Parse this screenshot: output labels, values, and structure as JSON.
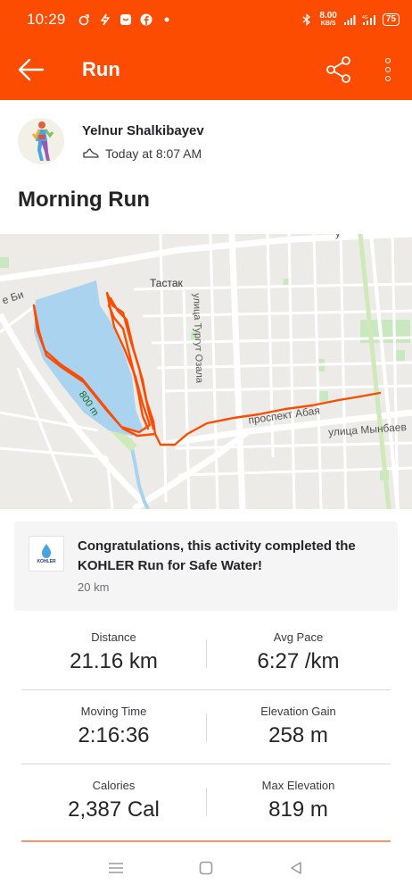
{
  "status_bar": {
    "time": "10:29",
    "net_speed_value": "8.00",
    "net_speed_unit": "KB/S",
    "battery": "75",
    "icons": [
      "strava-notification-icon",
      "lightning-icon",
      "chat-icon",
      "facebook-icon",
      "dot-icon",
      "bluetooth-icon",
      "signal-icon",
      "4g-signal-icon",
      "battery-icon"
    ]
  },
  "app_bar": {
    "title": "Run",
    "back_icon": "arrow-left-icon",
    "share_icon": "share-icon",
    "more_icon": "more-vertical-icon"
  },
  "athlete": {
    "name": "Yelnur Shalkibayev",
    "timestamp": "Today at 8:07 AM",
    "activity_icon": "shoe-icon"
  },
  "activity": {
    "title": "Morning Run"
  },
  "map": {
    "labels": {
      "district": "Тастак",
      "street_1": "улица Тургут Озала",
      "street_2": "проспект Абая",
      "street_3": "улица Мынбаев",
      "street_4": "е Би",
      "route_marker": "800 m",
      "top_fragment": "у"
    },
    "route_color": "#fc4c02",
    "water_color": "#aad3f0"
  },
  "challenge": {
    "title": "Congratulations, this activity completed the KOHLER Run for Safe Water!",
    "subtitle": "20 km",
    "badge_text": "KOHLER"
  },
  "stats": [
    {
      "left": {
        "label": "Distance",
        "value": "21.16 km"
      },
      "right": {
        "label": "Avg Pace",
        "value": "6:27 /km"
      }
    },
    {
      "left": {
        "label": "Moving Time",
        "value": "2:16:36"
      },
      "right": {
        "label": "Elevation Gain",
        "value": "258 m"
      }
    },
    {
      "left": {
        "label": "Calories",
        "value": "2,387 Cal"
      },
      "right": {
        "label": "Max Elevation",
        "value": "819 m"
      }
    }
  ],
  "nav_bar": {
    "icons": [
      "menu-icon",
      "home-square-icon",
      "back-triangle-icon"
    ]
  },
  "colors": {
    "brand": "#fc4c02",
    "text": "#242428",
    "muted": "#6d6d78"
  }
}
